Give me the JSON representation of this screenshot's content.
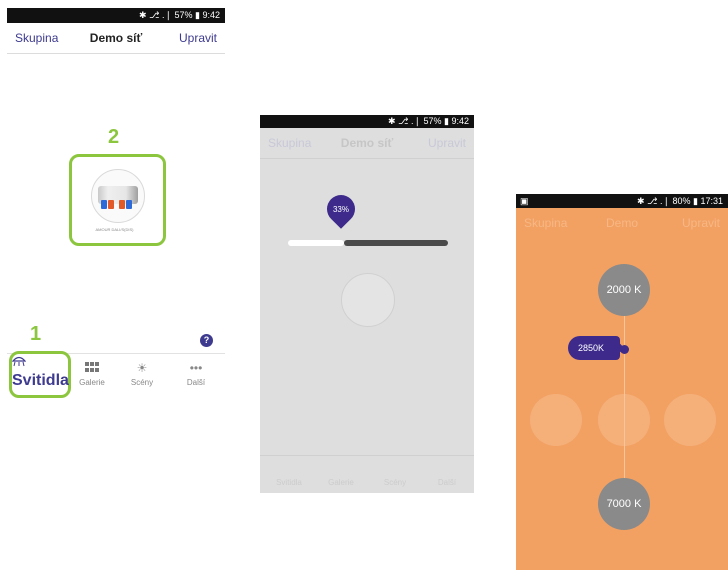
{
  "status_bar_1": "✱ ⎇ .❘ 57% ▮ 9:42",
  "status_bar_2": "✱ ⎇ .❘ 57% ▮ 9:42",
  "status_bar_3": "✱ ⎇ .❘ 80% ▮ 17:31",
  "phone1": {
    "header": {
      "left": "Skupina",
      "title": "Demo síť",
      "right": "Upravit"
    },
    "callout_1": "1",
    "callout_2": "2",
    "device_caption": "AMOUR DALI/S(DIS)",
    "help": "?",
    "tabs": [
      {
        "label": "Svitidla",
        "icon": "lamp-icon",
        "active": true
      },
      {
        "label": "Galerie",
        "icon": "grid-icon",
        "active": false
      },
      {
        "label": "Scény",
        "icon": "sun-icon",
        "active": false
      },
      {
        "label": "Další",
        "icon": "more-icon",
        "active": false
      }
    ]
  },
  "phone2": {
    "header": {
      "left": "Skupina",
      "title": "Demo síť",
      "right": "Upravit"
    },
    "dim_value": "33%",
    "dim_fraction": 0.33,
    "tabs": [
      "Svitidla",
      "Galerie",
      "Scény",
      "Další"
    ]
  },
  "phone3": {
    "header": {
      "left": "Skupina",
      "title": "Demo",
      "right": "Upravit"
    },
    "top_temp": "2000 K",
    "current_temp": "2850K",
    "bottom_temp": "7000 K"
  },
  "colors": {
    "accent_purple": "#3d3a8f",
    "callout_green": "#8cc63f",
    "orange_overlay": "#f2a163",
    "gray_overlay": "#dedede"
  }
}
